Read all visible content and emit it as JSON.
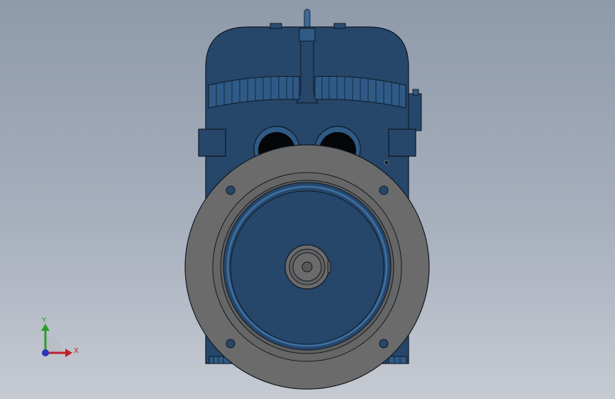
{
  "triad": {
    "x_label": "X",
    "y_label": "Y",
    "colors": {
      "x": "#c0202a",
      "y": "#2e9a2e",
      "z": "#2a36b8"
    }
  },
  "model": {
    "colors": {
      "body": "#26466a",
      "body_shade": "#1f3a5b",
      "fins": "#2f5a86",
      "flange": "#6b6b6b",
      "flange_inner": "#606060",
      "edge": "#101820",
      "bore_edge": "#3b6ea0"
    }
  }
}
